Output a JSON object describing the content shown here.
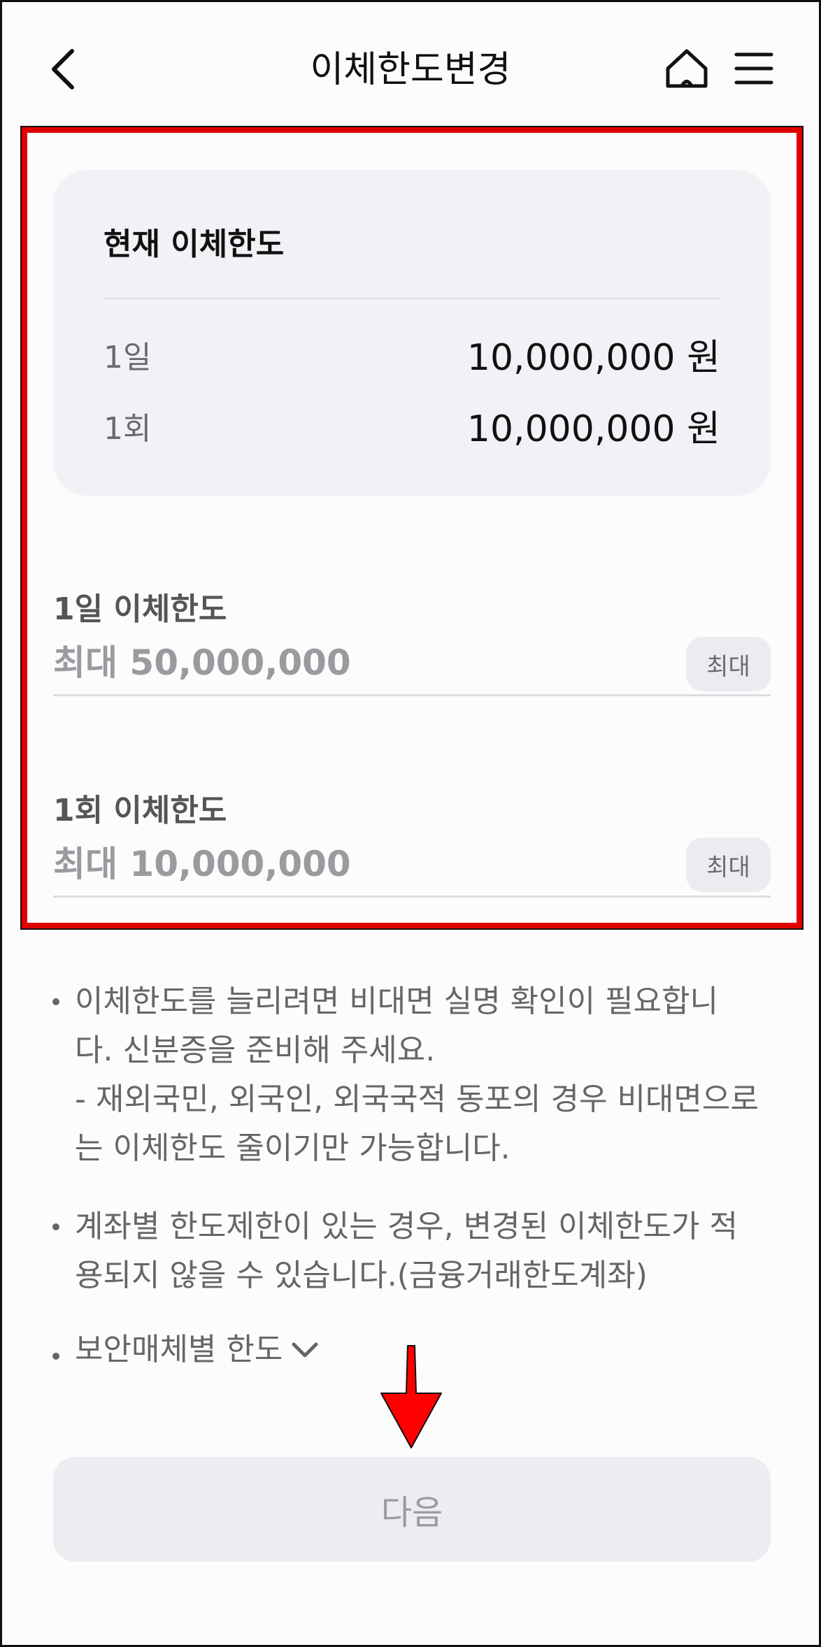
{
  "header": {
    "title": "이체한도변경",
    "back_icon": "chevron-left-icon",
    "home_icon": "home-icon",
    "menu_icon": "hamburger-menu-icon"
  },
  "current_limit": {
    "title": "현재 이체한도",
    "daily_label": "1일",
    "daily_value": "10,000,000 원",
    "per_transfer_label": "1회",
    "per_transfer_value": "10,000,000 원"
  },
  "daily_limit": {
    "label": "1일 이체한도",
    "placeholder": "최대 50,000,000",
    "value": "",
    "max_label": "최대"
  },
  "per_transfer_limit": {
    "label": "1회 이체한도",
    "placeholder": "최대 10,000,000",
    "value": "",
    "max_label": "최대"
  },
  "notices": {
    "notice1_line1": "이체한도를 늘리려면 비대면 실명 확인이 필요합니",
    "notice1_line2": "다. 신분증을 준비해 주세요.",
    "notice1_line3": "- 재외국민, 외국인, 외국국적 동포의 경우 비대면으로",
    "notice1_line4": "는 이체한도 줄이기만 가능합니다.",
    "notice2_line1": "계좌별 한도제한이 있는 경우, 변경된 이체한도가 적",
    "notice2_line2": "용되지 않을 수 있습니다.(금융거래한도계좌)",
    "security_label": "보안매체별 한도"
  },
  "footer": {
    "next_label": "다음"
  },
  "colors": {
    "highlight": "#e00000",
    "annotation_arrow": "#ff0000",
    "card_background": "#f1f2f5",
    "disabled_button": "#ededf1"
  }
}
